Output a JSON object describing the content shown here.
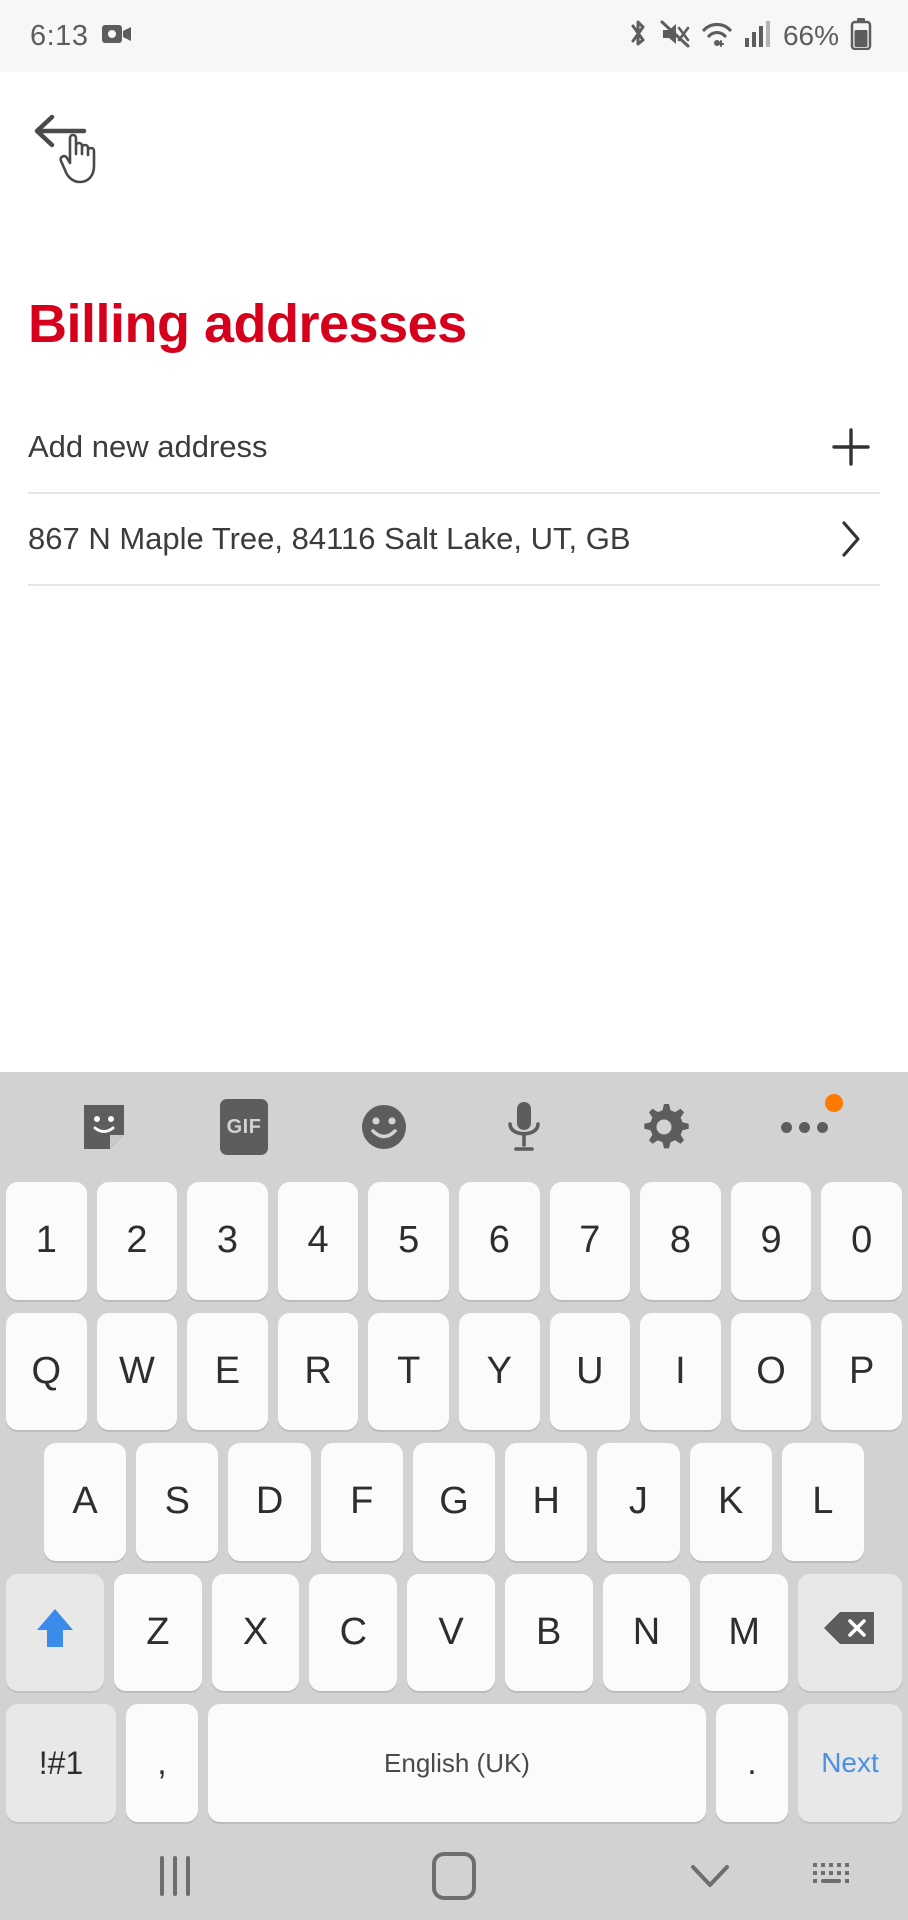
{
  "status_bar": {
    "time": "6:13",
    "battery_percent": "66%",
    "icons": [
      "video-record-icon",
      "bluetooth-icon",
      "mute-icon",
      "wifi-icon",
      "cellular-signal-icon",
      "battery-icon"
    ]
  },
  "screen": {
    "back_icon": "back-arrow-icon",
    "cursor": "hand-pointer-cursor",
    "title": "Billing addresses",
    "title_color": "#d6001c"
  },
  "list": {
    "rows": [
      {
        "label": "Add new address",
        "affordance": "+",
        "affordance_icon": "plus-icon"
      },
      {
        "label": "867 N  Maple Tree, 84116 Salt Lake, UT, GB",
        "affordance": "›",
        "affordance_icon": "chevron-right-icon"
      }
    ]
  },
  "keyboard": {
    "toolbar": [
      {
        "icon": "sticker-icon",
        "label": ""
      },
      {
        "icon": "gif-icon",
        "label": "GIF"
      },
      {
        "icon": "emoji-icon",
        "label": ""
      },
      {
        "icon": "microphone-icon",
        "label": ""
      },
      {
        "icon": "settings-gear-icon",
        "label": ""
      },
      {
        "icon": "more-options-icon",
        "label": "",
        "badge": true
      }
    ],
    "row_numbers": [
      "1",
      "2",
      "3",
      "4",
      "5",
      "6",
      "7",
      "8",
      "9",
      "0"
    ],
    "row_top": [
      "Q",
      "W",
      "E",
      "R",
      "T",
      "Y",
      "U",
      "I",
      "O",
      "P"
    ],
    "row_home": [
      "A",
      "S",
      "D",
      "F",
      "G",
      "H",
      "J",
      "K",
      "L"
    ],
    "row_bottom": [
      "Z",
      "X",
      "C",
      "V",
      "B",
      "N",
      "M"
    ],
    "shift_label": "",
    "backspace_label": "",
    "symbols_label": "!#1",
    "comma_label": ",",
    "space_label": "English (UK)",
    "period_label": ".",
    "next_label": "Next",
    "next_color": "#4a90e2",
    "shift_color": "#3b8beb"
  },
  "nav_bar": {
    "recents": "recents-icon",
    "home": "home-icon",
    "back": "collapse-keyboard-icon",
    "keyboard_switch": "keyboard-switch-icon"
  }
}
